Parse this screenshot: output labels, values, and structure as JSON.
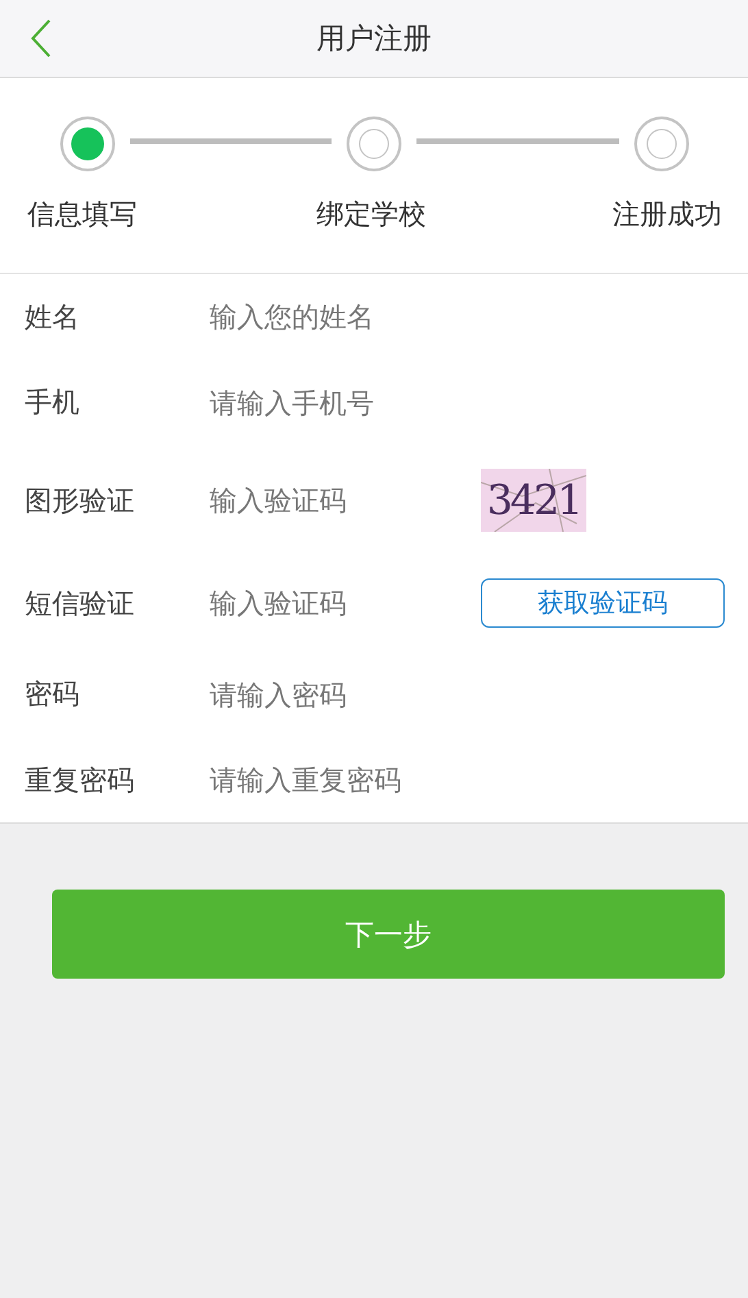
{
  "header": {
    "title": "用户注册"
  },
  "steps": [
    {
      "label": "信息填写",
      "selected": true
    },
    {
      "label": "绑定学校",
      "selected": false
    },
    {
      "label": "注册成功",
      "selected": false
    }
  ],
  "fields": [
    {
      "kind": "plain",
      "label": "姓名",
      "placeholder": "输入您的姓名"
    },
    {
      "kind": "plain",
      "label": "手机",
      "placeholder": "请输入手机号"
    },
    {
      "kind": "captcha",
      "label": "图形验证",
      "placeholder": "输入验证码",
      "captcha": "3421"
    },
    {
      "kind": "sms",
      "label": "短信验证",
      "placeholder": "输入验证码",
      "button": "获取验证码"
    },
    {
      "kind": "plain",
      "label": "密码",
      "placeholder": "请输入密码"
    },
    {
      "kind": "plain",
      "label": "重复密码",
      "placeholder": "请输入重复密码"
    }
  ],
  "next_button": "下一步"
}
